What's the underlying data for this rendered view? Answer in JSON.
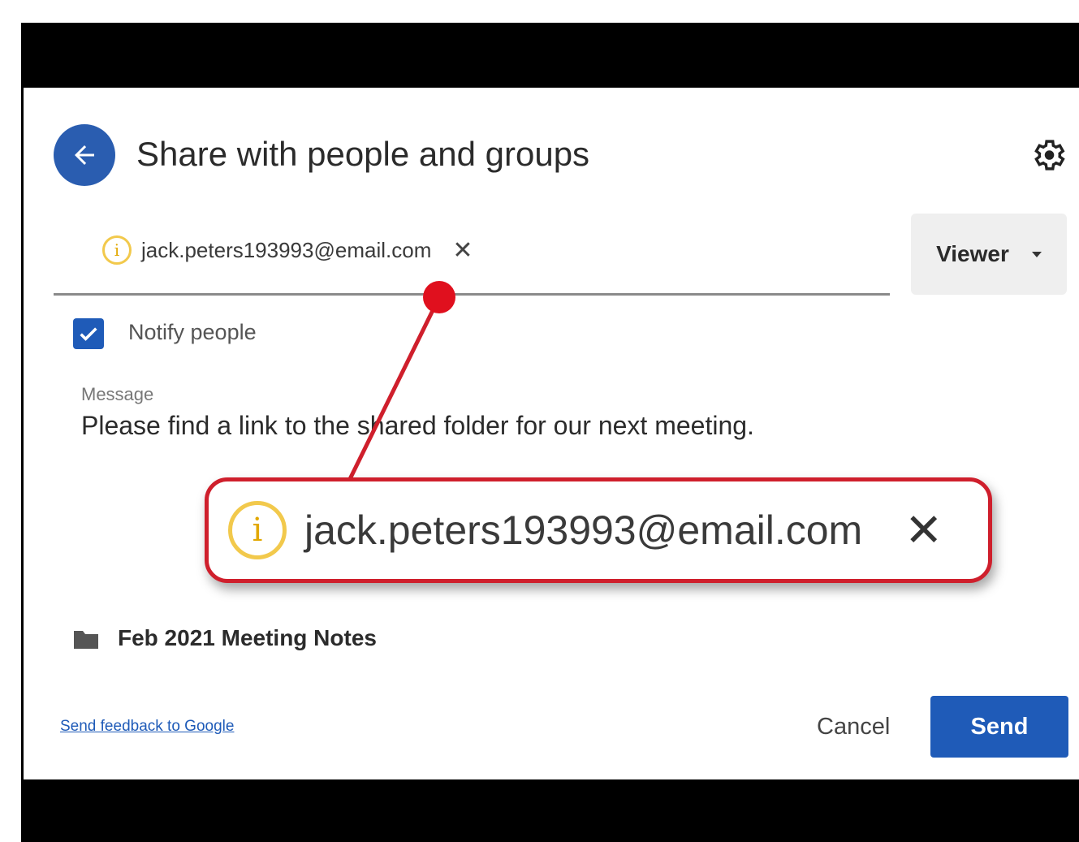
{
  "dialog": {
    "title": "Share with people and groups",
    "back_icon": "arrow-left-icon",
    "settings_icon": "gear-icon"
  },
  "recipient": {
    "email": "jack.peters193993@email.com",
    "status_icon": "info-icon",
    "status_color": "#f2c94c",
    "remove_icon": "close-icon",
    "remove_glyph": "✕",
    "info_glyph": "i"
  },
  "role": {
    "selected": "Viewer"
  },
  "notify": {
    "label": "Notify people",
    "checked": true
  },
  "message": {
    "label": "Message",
    "text": "Please find a link to the shared folder for our next meeting."
  },
  "item": {
    "name": "Feb 2021 Meeting Notes",
    "icon": "folder-icon"
  },
  "footer": {
    "feedback_link": "Send feedback to Google",
    "cancel_label": "Cancel",
    "send_label": "Send"
  },
  "colors": {
    "accent": "#1f5bb8",
    "annotation": "#cf1f2c"
  }
}
